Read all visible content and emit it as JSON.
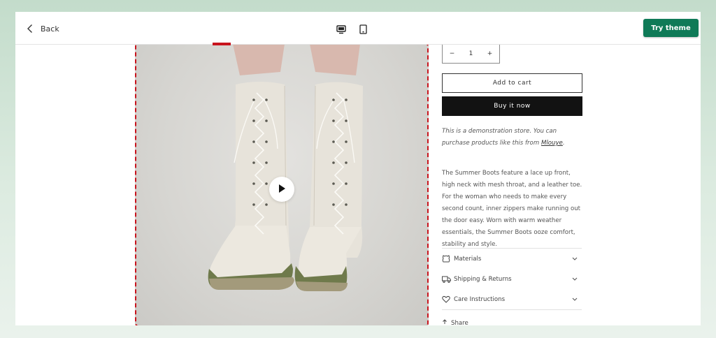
{
  "topbar": {
    "back_label": "Back",
    "try_label": "Try theme",
    "brand_color": "#0f7a57"
  },
  "product": {
    "quantity": {
      "minus": "−",
      "value": "1",
      "plus": "+"
    },
    "add_to_cart": "Add to cart",
    "buy_now": "Buy it now",
    "demo_text": "This is a demonstration store. You can purchase products like this from",
    "demo_link": "Mlouye",
    "demo_end": ".",
    "description": "The Summer Boots feature a lace up front, high neck with mesh throat, and a leather toe. For the woman who needs to make every second count, inner zippers make running out the door easy. Worn with warm weather essentials, the Summer Boots ooze comfort, stability and style.",
    "accordion": [
      {
        "label": "Materials",
        "icon": "leather-icon"
      },
      {
        "label": "Shipping & Returns",
        "icon": "truck-icon"
      },
      {
        "label": "Care Instructions",
        "icon": "heart-icon"
      }
    ],
    "share_label": "Share"
  },
  "media": {
    "highlight_color": "#c8141d",
    "play_icon": "play-icon"
  }
}
